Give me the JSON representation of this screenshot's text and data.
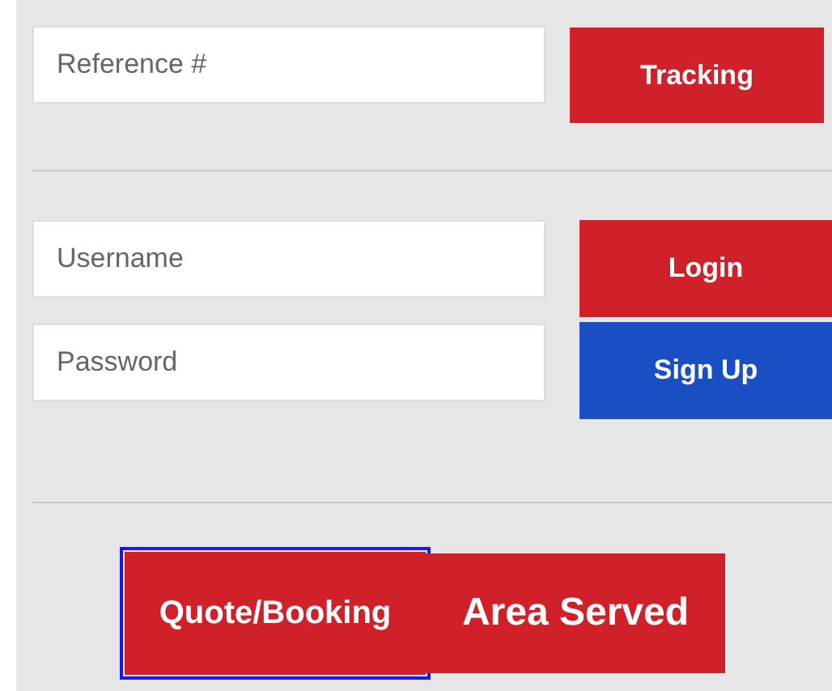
{
  "tracking": {
    "reference": {
      "placeholder": "Reference #"
    },
    "button": "Tracking"
  },
  "login": {
    "username": {
      "placeholder": "Username"
    },
    "password": {
      "placeholder": "Password"
    },
    "buttons": [
      {
        "label": "Login",
        "kind": "primary"
      },
      {
        "label": "Sign Up",
        "kind": "secondary"
      }
    ]
  },
  "actions": [
    {
      "label": "Quote/Booking",
      "focused": true
    },
    {
      "label": "Area Served",
      "focused": false
    }
  ]
}
